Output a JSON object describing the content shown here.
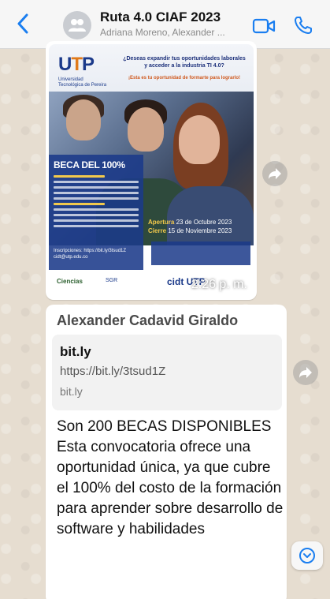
{
  "header": {
    "title": "Ruta 4.0 CIAF 2023",
    "subtitle": "Adriana Moreno, Alexander ...",
    "back_icon": "chevron-left-icon",
    "avatar_icon": "group-avatar-icon",
    "video_icon": "video-camera-icon",
    "call_icon": "phone-icon",
    "accent_color": "#1a7ef0"
  },
  "image_message": {
    "poster": {
      "logo_text_u": "U",
      "logo_text_t": "T",
      "logo_text_p": "P",
      "logo_subtitle": "Universidad Tecnológica de Pereira",
      "headline": "¿Deseas expandir tus oportunidades laborales y acceder a la industria TI 4.0?",
      "subheadline": "¡Esta es tu oportunidad de formarte para lograrlo!",
      "beca_title": "BECA DEL 100%",
      "inscriptions": "Inscripciones: https://bit.ly/3tsud1Z",
      "email": "cidt@utp.edu.co",
      "apertura_label": "Apertura",
      "apertura_date": "23 de Octubre 2023",
      "cierre_label": "Cierre",
      "cierre_date": "15 de Noviembre 2023",
      "bottom_logo_1": "Ciencias",
      "bottom_logo_2": "SGR",
      "bottom_logo_3": "cidt UTP"
    },
    "time": "2:26 p. m."
  },
  "text_message": {
    "sender": "Alexander  Cadavid Giraldo",
    "link_preview": {
      "title": "bit.ly",
      "url": "https://bit.ly/3tsud1Z",
      "domain": "bit.ly"
    },
    "body": "Son 200 BECAS DISPONIBLES\nEsta convocatoria ofrece una oportunidad única, ya que cubre el 100% del costo de la formación para aprender sobre desarrollo de software y habilidades"
  },
  "controls": {
    "forward_icon": "share-forward-icon",
    "scroll_down_icon": "chevron-down-circle-icon"
  }
}
